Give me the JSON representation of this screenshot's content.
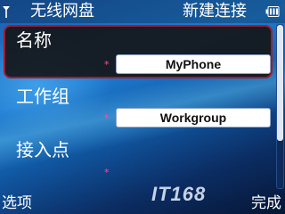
{
  "header": {
    "title": "无线网盘",
    "action_title": "新建连接"
  },
  "fields": [
    {
      "label": "名称",
      "required_mark": "*",
      "value": "MyPhone"
    },
    {
      "label": "工作组",
      "required_mark": "*",
      "value": "Workgroup"
    },
    {
      "label": "接入点",
      "required_mark": "*",
      "value": ""
    }
  ],
  "softkeys": {
    "left": "选项",
    "right": "完成"
  },
  "watermark": {
    "text": "IT168"
  },
  "colors": {
    "selected_border": "#a01c2c",
    "required_mark": "#ff4aa6"
  },
  "icons": {
    "signal": "antenna-icon",
    "battery": "battery-icon"
  }
}
